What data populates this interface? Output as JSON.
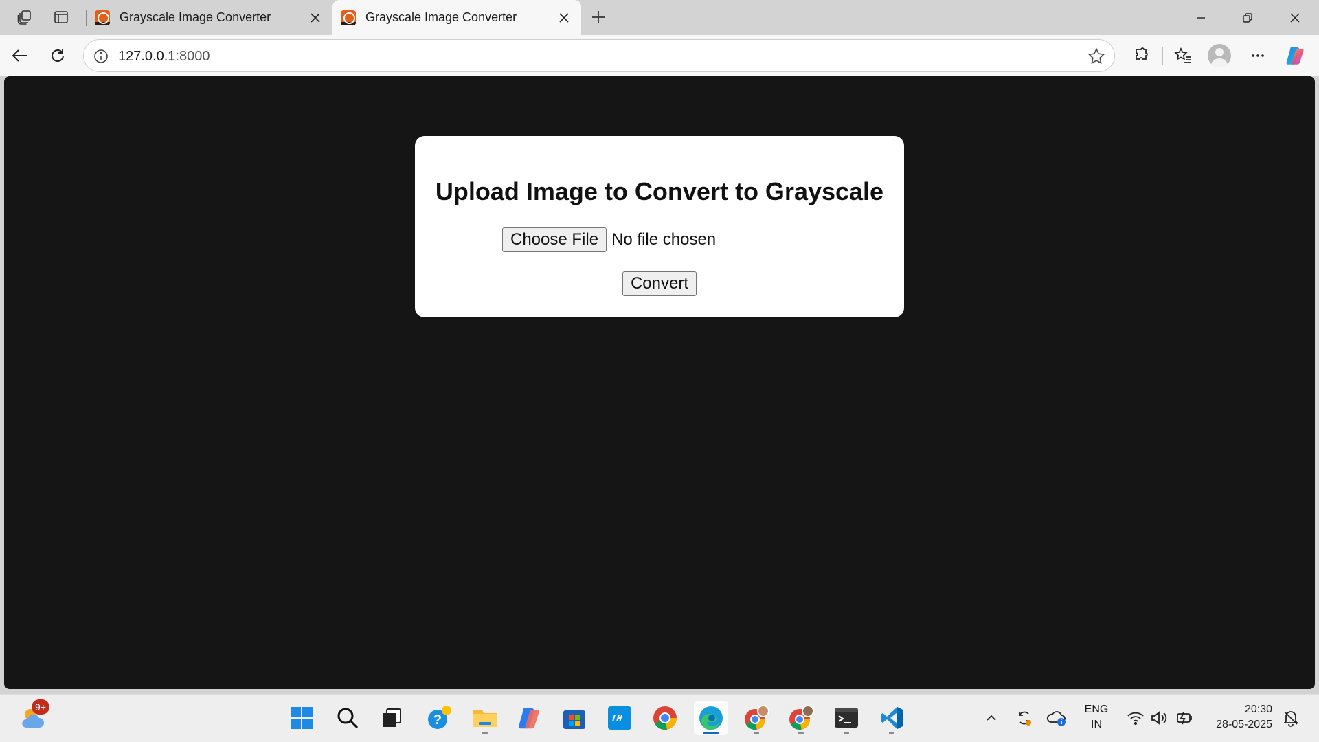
{
  "browser": {
    "tabs": [
      {
        "title": "Grayscale Image Converter",
        "active": false
      },
      {
        "title": "Grayscale Image Converter",
        "active": true
      }
    ],
    "address": {
      "host": "127.0.0.1",
      "port": ":8000"
    }
  },
  "page": {
    "heading": "Upload Image to Convert to Grayscale",
    "file_button_label": "Choose File",
    "file_status": "No file chosen",
    "convert_label": "Convert"
  },
  "taskbar": {
    "weather_badge": "9+",
    "language": {
      "line1": "ENG",
      "line2": "IN"
    },
    "clock": {
      "time": "20:30",
      "date": "28-05-2025"
    }
  },
  "colors": {
    "page_background": "#151515",
    "card_background": "#ffffff",
    "tab_favicon": "#e2601b",
    "taskbar_active_indicator": "#0f6cbd"
  }
}
